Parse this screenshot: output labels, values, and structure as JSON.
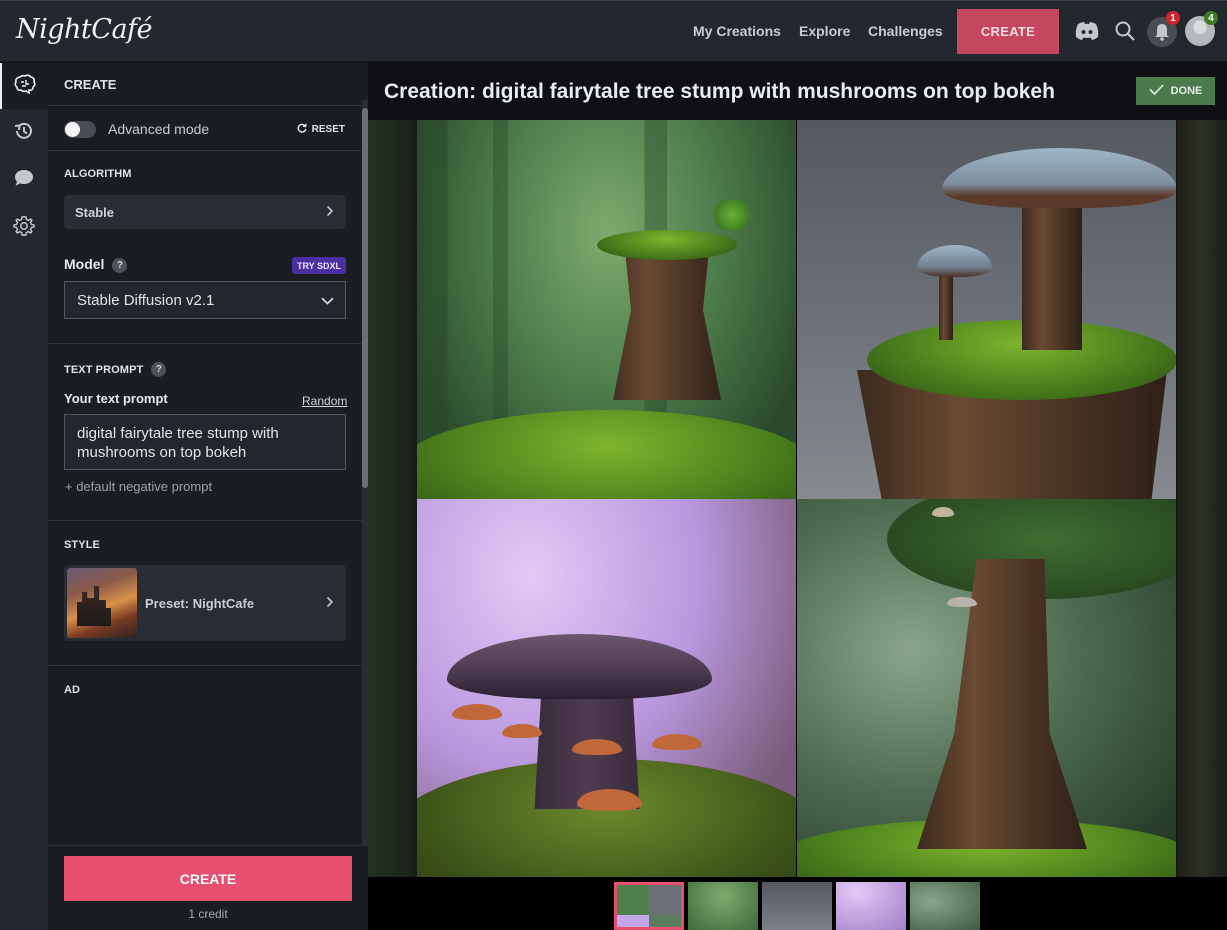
{
  "header": {
    "logo": "NightCafé",
    "nav": [
      "My Creations",
      "Explore",
      "Challenges"
    ],
    "create_label": "CREATE",
    "notifications_count": "1",
    "profile_badge_count": "4",
    "icons": [
      "discord-icon",
      "search-icon",
      "bell-icon",
      "avatar"
    ]
  },
  "icon_rail": {
    "items": [
      "brain-icon",
      "history-icon",
      "chat-icon",
      "gear-icon"
    ],
    "active": "brain-icon"
  },
  "panel": {
    "title": "CREATE",
    "advanced_mode_label": "Advanced mode",
    "advanced_mode_on": false,
    "reset_label": "RESET",
    "algorithm_heading": "ALGORITHM",
    "algorithm_value": "Stable",
    "model_label": "Model",
    "try_sdxl_label": "TRY SDXL",
    "model_value": "Stable Diffusion v2.1",
    "text_prompt_heading": "TEXT PROMPT",
    "your_prompt_label": "Your text prompt",
    "random_label": "Random",
    "prompt_value": "digital fairytale tree stump with mushrooms on top bokeh",
    "negative_prompt_link": "+ default negative prompt",
    "style_heading": "STYLE",
    "style_value": "Preset: NightCafe",
    "ad_heading": "AD",
    "create_label": "CREATE",
    "credit_text": "1 credit",
    "help_glyph": "?"
  },
  "main": {
    "title": "Creation: digital fairytale tree stump with mushrooms on top bokeh",
    "done_label": "DONE",
    "images": [
      {
        "name": "image-1",
        "description": "tree stump with small plant on top in green forest"
      },
      {
        "name": "image-2",
        "description": "large blue-capped mushrooms on mossy stump"
      },
      {
        "name": "image-3",
        "description": "purple stump with orange mushrooms"
      },
      {
        "name": "image-4",
        "description": "tall tree stump with small mushrooms in green forest"
      }
    ],
    "thumbnails": [
      "grid",
      "image-1",
      "image-2",
      "image-3",
      "image-4"
    ],
    "selected_thumbnail": "grid"
  },
  "colors": {
    "accent": "#e64f6d",
    "nav_create": "#c5475f",
    "done": "#4b7a4d",
    "sdxl": "#4a2fa0",
    "notification": "#d1242f",
    "profile_badge": "#3c7a24"
  }
}
